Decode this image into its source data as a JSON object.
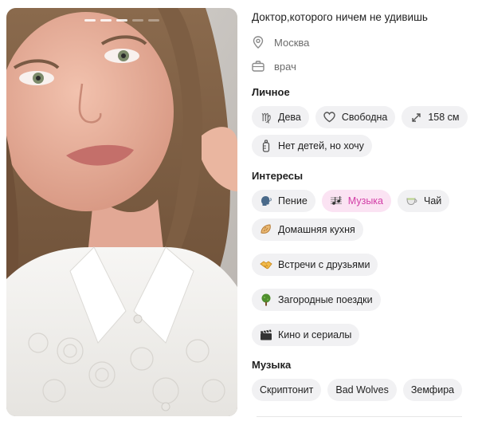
{
  "profile": {
    "headline": "Доктор,которого ничем не удивишь",
    "city": "Москва",
    "job": "врач"
  },
  "sections": {
    "personal_title": "Личное",
    "interests_title": "Интересы",
    "music_title": "Музыка"
  },
  "personal": [
    {
      "label": "Дева",
      "icon": "virgo-icon"
    },
    {
      "label": "Свободна",
      "icon": "heart-icon"
    },
    {
      "label": "158 см",
      "icon": "height-arrows-icon"
    },
    {
      "label": "Нет детей, но хочу",
      "icon": "baby-bottle-icon"
    }
  ],
  "interests": [
    {
      "label": "Пение",
      "icon": "speaking-head-icon"
    },
    {
      "label": "Музыка",
      "icon": "musical-score-icon",
      "highlighted": true
    },
    {
      "label": "Чай",
      "icon": "tea-cup-icon"
    },
    {
      "label": "Домашняя кухня",
      "icon": "flatbread-icon"
    },
    {
      "label": "Встречи с друзьями",
      "icon": "handshake-icon"
    },
    {
      "label": "Загородные поездки",
      "icon": "tree-icon"
    },
    {
      "label": "Кино и сериалы",
      "icon": "clapper-board-icon"
    }
  ],
  "music": [
    {
      "label": "Скриптонит"
    },
    {
      "label": "Bad Wolves"
    },
    {
      "label": "Земфира"
    }
  ],
  "colors": {
    "highlight_bg": "#fbe3f3",
    "highlight_text": "#d23da6",
    "chip_bg": "#f1f1f3"
  }
}
